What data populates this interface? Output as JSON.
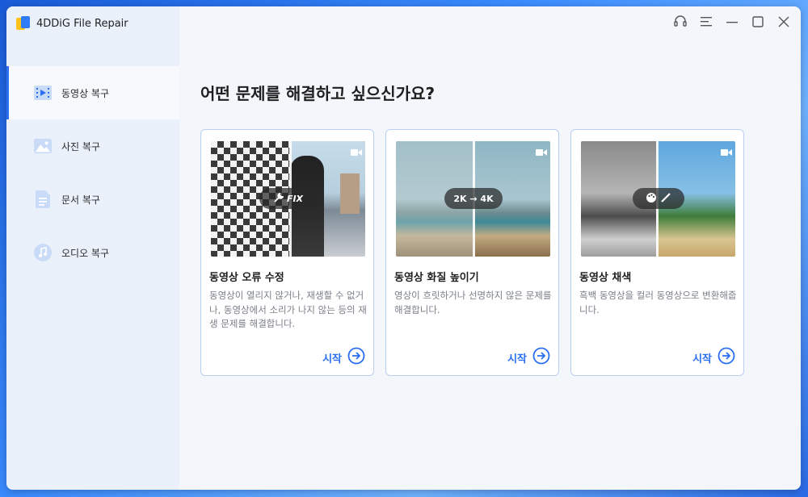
{
  "app": {
    "name": "4DDiG File Repair"
  },
  "sidebar": {
    "items": [
      {
        "label": "동영상 복구",
        "icon": "video-icon",
        "active": true
      },
      {
        "label": "사진 복구",
        "icon": "photo-icon",
        "active": false
      },
      {
        "label": "문서 복구",
        "icon": "document-icon",
        "active": false
      },
      {
        "label": "오디오 복구",
        "icon": "audio-icon",
        "active": false
      }
    ]
  },
  "main": {
    "heading": "어떤 문제를 해결하고 싶으신가요?",
    "cards": [
      {
        "title": "동영상 오류 수정",
        "description": "동영상이 열리지 않거나, 재생할 수 없거나, 동영상에서 소리가 나지 않는 등의 재생 문제를 해결합니다.",
        "start_label": "시작",
        "overlay_text": "FIX"
      },
      {
        "title": "동영상 화질 높이기",
        "description": "영상이 흐릿하거나 선명하지 않은 문제를 해결합니다.",
        "start_label": "시작",
        "overlay_text": "2K → 4K"
      },
      {
        "title": "동영상 채색",
        "description": "흑백 동영상을 컬러 동영상으로 변환해줍니다.",
        "start_label": "시작",
        "overlay_text": ""
      }
    ]
  },
  "colors": {
    "accent": "#2a6ff2",
    "sidebar_bg": "#eaf1fb",
    "card_border": "#b9cff1"
  }
}
